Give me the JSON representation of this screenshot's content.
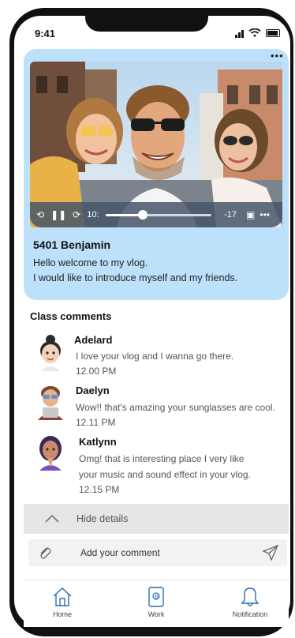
{
  "status_bar": {
    "time": "9:41"
  },
  "vlog": {
    "author": "5401 Benjamin",
    "description_lines": [
      "Hello welcome to my vlog.",
      "I would like to introduce myself and my friends."
    ],
    "player": {
      "current_time": "10:",
      "remaining_time": "-17",
      "progress": 0.35
    }
  },
  "comments_section": {
    "title": "Class comments",
    "comments": [
      {
        "name": "Adelard",
        "lines": [
          "I love your vlog and I wanna go there."
        ],
        "time": "12.00 PM"
      },
      {
        "name": "Daelyn",
        "lines": [
          "Wow!! that's amazing your sunglasses are cool."
        ],
        "time": "12.11 PM"
      },
      {
        "name": "Katlynn",
        "lines": [
          "Omg! that is interesting place I very like",
          "your music and sound effect in your vlog."
        ],
        "time": "12.15 PM"
      }
    ]
  },
  "hide_details": {
    "label": "Hide details"
  },
  "comment_input": {
    "placeholder": "Add your comment"
  },
  "tabs": [
    {
      "label": "Home",
      "icon": "home-icon"
    },
    {
      "label": "Work",
      "icon": "work-icon"
    },
    {
      "label": "Notification",
      "icon": "bell-icon"
    }
  ],
  "colors": {
    "card_background": "#bde0fb",
    "accent": "#2a6fb0"
  }
}
